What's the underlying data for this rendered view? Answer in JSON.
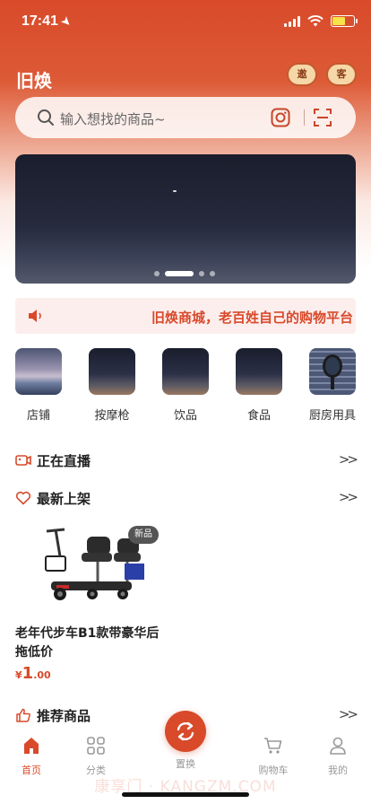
{
  "status_bar": {
    "time": "17:41"
  },
  "header": {
    "title": "旧焕",
    "badge_left": "邀",
    "badge_right": "客",
    "search_placeholder": "输入想找的商品~"
  },
  "banner": {
    "dot_count": 4,
    "active_dot": 1
  },
  "notice": {
    "text": "旧焕商城，老百姓自己的购物平台"
  },
  "categories": [
    {
      "label": "店铺"
    },
    {
      "label": "按摩枪"
    },
    {
      "label": "饮品"
    },
    {
      "label": "食品"
    },
    {
      "label": "厨房用具"
    }
  ],
  "sections": {
    "live": {
      "title": "正在直播",
      "more": ">>"
    },
    "new_arrivals": {
      "title": "最新上架",
      "more": ">>"
    },
    "recommended": {
      "title": "推荐商品",
      "more": ">>"
    }
  },
  "product": {
    "badge": "新品",
    "name": "老年代步车B1款带豪华后拖低价",
    "price_symbol": "¥",
    "price_int": "1",
    "price_dec": ".00"
  },
  "tabbar": {
    "home": "首页",
    "category": "分类",
    "exchange": "置换",
    "cart": "购物车",
    "mine": "我的"
  },
  "watermark": "康享门 · KANGZM.COM",
  "colors": {
    "accent": "#d84a2a",
    "header_top": "#d84a2a",
    "notice_bg": "#fdeeee"
  }
}
